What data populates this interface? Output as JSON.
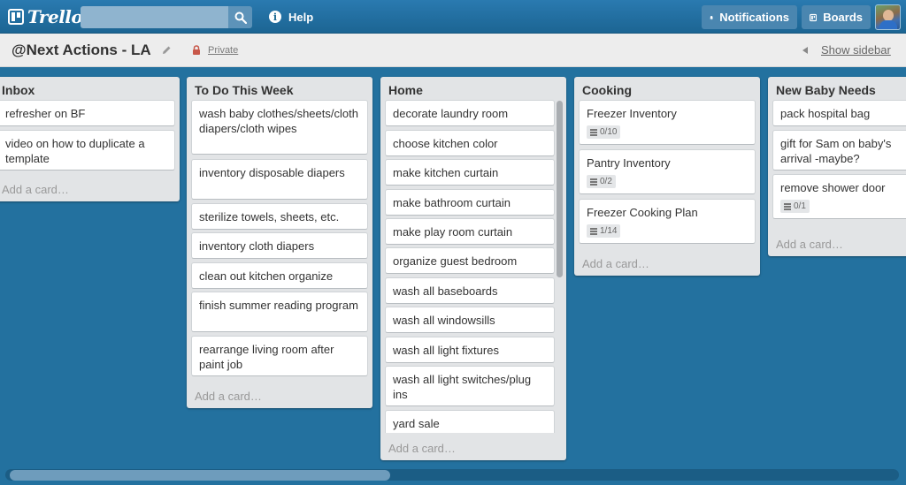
{
  "app": {
    "logo_text": "Trello"
  },
  "search": {
    "value": "",
    "placeholder": ""
  },
  "nav": {
    "help_label": "Help",
    "notifications_label": "Notifications",
    "boards_label": "Boards"
  },
  "board": {
    "title": "@Next Actions - LA",
    "visibility": "Private",
    "show_sidebar_label": "Show sidebar"
  },
  "add_card_label": "Add a card…",
  "lists": [
    {
      "title": "Inbox",
      "cards": [
        {
          "text": "refresher on BF"
        },
        {
          "text": "video on how to duplicate a template"
        }
      ]
    },
    {
      "title": "To Do This Week",
      "cards": [
        {
          "text": "wash baby clothes/sheets/cloth diapers/cloth wipes"
        },
        {
          "text": "inventory disposable diapers"
        },
        {
          "text": "sterilize towels, sheets, etc."
        },
        {
          "text": "inventory cloth diapers"
        },
        {
          "text": "clean out kitchen organize"
        },
        {
          "text": "finish summer reading program"
        },
        {
          "text": "rearrange living room after paint job"
        }
      ]
    },
    {
      "title": "Home",
      "cards": [
        {
          "text": "decorate laundry room"
        },
        {
          "text": "choose kitchen color"
        },
        {
          "text": "make kitchen curtain"
        },
        {
          "text": "make bathroom curtain"
        },
        {
          "text": "make play room curtain"
        },
        {
          "text": "organize guest bedroom"
        },
        {
          "text": "wash all baseboards"
        },
        {
          "text": "wash all windowsills"
        },
        {
          "text": "wash all light fixtures"
        },
        {
          "text": "wash all light switches/plug ins"
        },
        {
          "text": "yard sale"
        }
      ]
    },
    {
      "title": "Cooking",
      "cards": [
        {
          "text": "Freezer Inventory",
          "checklist": "0/10"
        },
        {
          "text": "Pantry Inventory",
          "checklist": "0/2"
        },
        {
          "text": "Freezer Cooking Plan",
          "checklist": "1/14"
        }
      ]
    },
    {
      "title": "New Baby Needs",
      "cards": [
        {
          "text": "pack hospital bag"
        },
        {
          "text": "gift for Sam on baby's arrival -maybe?"
        },
        {
          "text": "remove shower door",
          "checklist": "0/1"
        }
      ]
    }
  ],
  "colors": {
    "board_background": "#23719f",
    "header_bar": "#1f6b94",
    "list_background": "#e2e4e6"
  },
  "icons": [
    "trello-logo-icon",
    "search-icon",
    "info-icon",
    "bell-icon",
    "boards-icon",
    "pencil-icon",
    "lock-icon",
    "checklist-icon"
  ]
}
